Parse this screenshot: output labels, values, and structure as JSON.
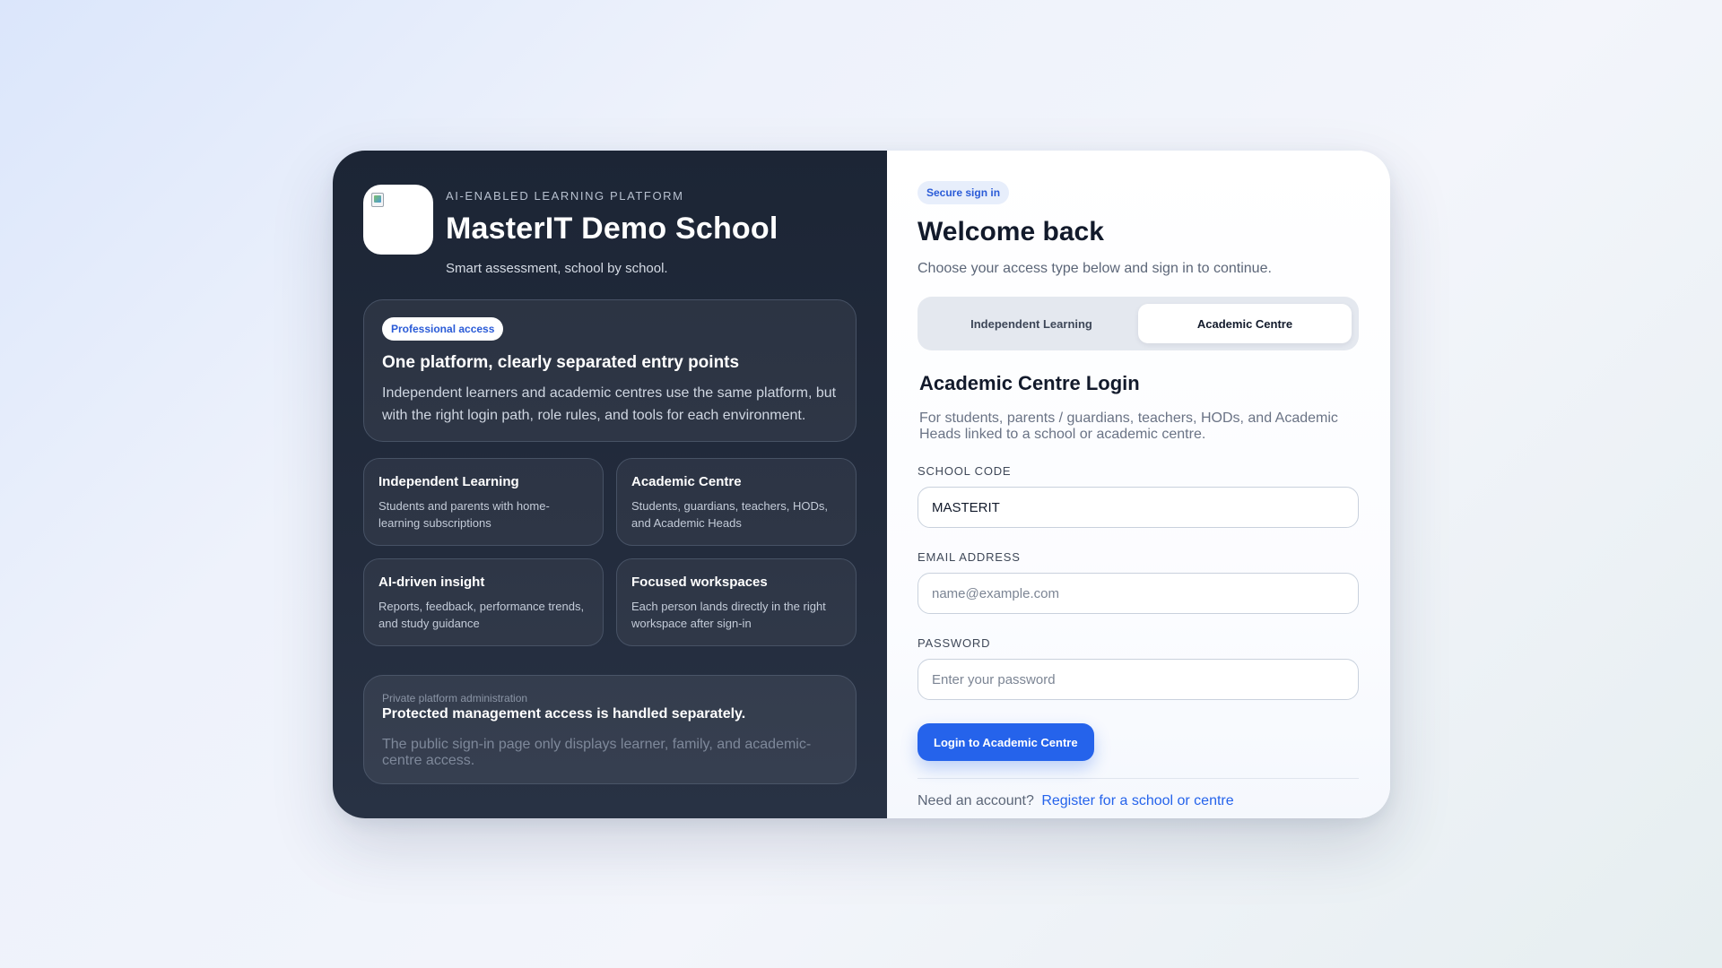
{
  "brand": {
    "logo_icon": "school-logo-broken-image-icon",
    "eyebrow": "AI-ENABLED LEARNING PLATFORM",
    "school_name": "MasterIT Demo School",
    "tagline": "Smart assessment, school by school."
  },
  "hero": {
    "badge": "Professional access",
    "title": "One platform, clearly separated entry points",
    "body": "Independent learners and academic centres use the same platform, but with the right login path, role rules, and tools for each environment."
  },
  "features": [
    {
      "title": "Independent Learning",
      "body": "Students and parents with home-learning subscriptions"
    },
    {
      "title": "Academic Centre",
      "body": "Students, guardians, teachers, HODs, and Academic Heads"
    },
    {
      "title": "AI-driven insight",
      "body": "Reports, feedback, performance trends, and study guidance"
    },
    {
      "title": "Focused workspaces",
      "body": "Each person lands directly in the right workspace after sign-in"
    }
  ],
  "admin": {
    "eyebrow": "Private platform administration",
    "title": "Protected management access is handled separately.",
    "body": "The public sign-in page only displays learner, family, and academic-centre access."
  },
  "signin": {
    "badge": "Secure sign in",
    "title": "Welcome back",
    "subtitle": "Choose your access type below and sign in to continue.",
    "tabs": [
      {
        "label": "Independent Learning",
        "active": false
      },
      {
        "label": "Academic Centre",
        "active": true
      }
    ],
    "form_title": "Academic Centre Login",
    "form_subtitle": "For students, parents / guardians, teachers, HODs, and Academic Heads linked to a school or academic centre.",
    "fields": {
      "school_code": {
        "label": "SCHOOL CODE",
        "value": "MASTERIT",
        "placeholder": ""
      },
      "email": {
        "label": "EMAIL ADDRESS",
        "value": "",
        "placeholder": "name@example.com"
      },
      "password": {
        "label": "PASSWORD",
        "value": "",
        "placeholder": "Enter your password"
      }
    },
    "submit_label": "Login to Academic Centre",
    "footer_text": "Need an account?",
    "footer_link": "Register for a school or centre"
  },
  "colors": {
    "accent": "#2563eb",
    "left_panel": "#1c2535",
    "heading": "#121a2b"
  }
}
